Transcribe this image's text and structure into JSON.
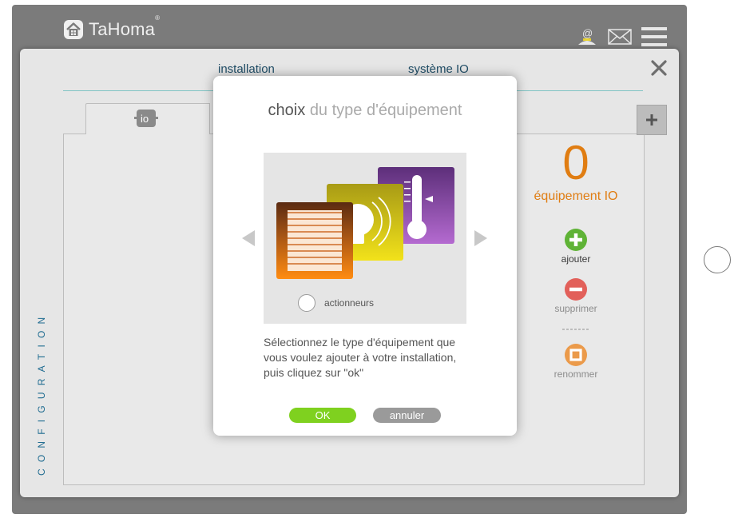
{
  "header": {
    "brand": "TaHoma",
    "brand_mark": "®",
    "icons": [
      "home-icon",
      "at-user-icon",
      "mail-icon",
      "hamburger-menu-icon"
    ]
  },
  "panel": {
    "tabs": [
      {
        "label": "installation"
      },
      {
        "label": "système IO"
      }
    ],
    "io_tab_icon": "io-icon",
    "side_label": "CONFIGURATION",
    "stats": {
      "count": "0",
      "count_label": "équipement IO"
    },
    "actions": {
      "add": "ajouter",
      "delete": "supprimer",
      "separator": "-------",
      "rename": "renommer"
    }
  },
  "modal": {
    "title_strong": "choix",
    "title_light": "du type d'équipement",
    "option_label": "actionneurs",
    "description": "Sélectionnez le type d'équipement que vous voulez ajouter à votre installation, puis cliquez sur \"ok\"",
    "ok_label": "OK",
    "cancel_label": "annuler"
  },
  "colors": {
    "accent_orange": "#e07d12",
    "accent_blue": "#1e6b90",
    "ok_green": "#7fd11f",
    "add_green": "#5fb336",
    "delete_red": "#e2605a",
    "rename_orange": "#eb9a4a"
  }
}
